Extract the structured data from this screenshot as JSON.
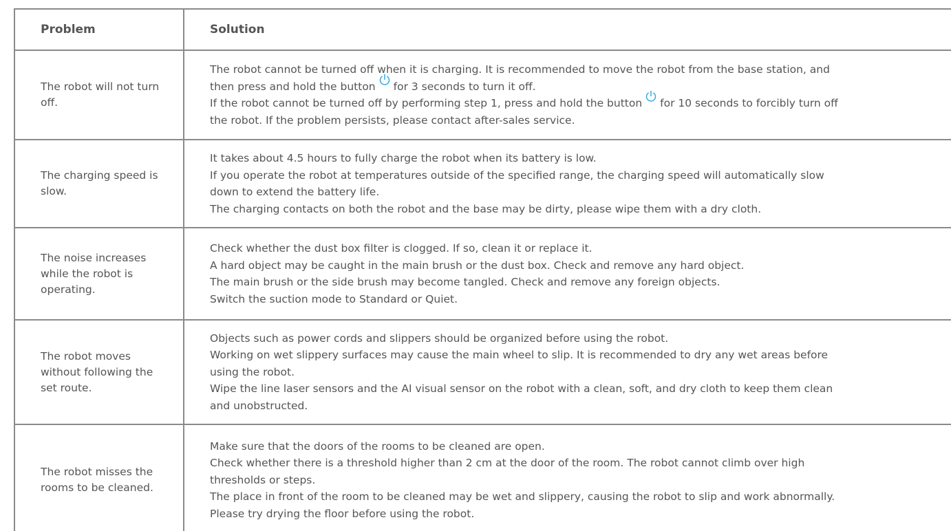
{
  "header": {
    "problem": "Problem",
    "solution": "Solution"
  },
  "icon": "power-icon",
  "accent_color": "#29a3e0",
  "rows": [
    {
      "problem": "The robot will not turn off.",
      "solution": [
        {
          "text": "The robot cannot be turned off when it is charging. It is recommended to move the robot from the base station, and"
        },
        {
          "pre": "then press and hold the button",
          "icon": true,
          "post": "for 3 seconds to turn it off."
        },
        {
          "pre": "If the robot cannot be turned off by performing step 1, press and hold the button",
          "icon": true,
          "post": "for 10 seconds to forcibly turn off"
        },
        {
          "text": "the robot. If the problem persists, please contact after-sales service."
        }
      ]
    },
    {
      "problem": "The charging speed is slow.",
      "solution": [
        {
          "text": "It takes about 4.5 hours to fully charge the robot when its battery is low."
        },
        {
          "text": "If you operate the robot at temperatures outside of the specified range, the charging speed will automatically slow"
        },
        {
          "text": "down to extend the battery life."
        },
        {
          "text": "The charging contacts on both the robot and the base may be dirty, please wipe them with a dry cloth."
        }
      ]
    },
    {
      "problem": "The noise increases while the robot is operating.",
      "solution": [
        {
          "text": "Check whether the dust box filter is clogged. If so, clean it or replace it."
        },
        {
          "text": "A hard object may be caught in the main brush or the dust box. Check and remove any hard object."
        },
        {
          "text": "The main brush or the side brush may become tangled. Check and remove any foreign objects."
        },
        {
          "text": "Switch the suction mode to Standard or Quiet."
        }
      ]
    },
    {
      "problem": "The robot moves without following the set route.",
      "solution": [
        {
          "text": "Objects such as power cords and slippers should be organized before using the robot."
        },
        {
          "text": "Working on wet slippery surfaces may cause the main wheel to slip. It is recommended to dry any wet areas before"
        },
        {
          "text": "using the robot."
        },
        {
          "text": "Wipe the line laser sensors and the AI visual sensor on the robot with a clean, soft, and dry cloth to keep them clean"
        },
        {
          "text": "and unobstructed."
        }
      ]
    },
    {
      "problem": "The robot misses the rooms to be cleaned.",
      "solution": [
        {
          "text": "Make sure that the doors of the rooms to be cleaned are open."
        },
        {
          "text": "Check whether there is a threshold higher than 2 cm at the door of the room. The robot cannot climb over high"
        },
        {
          "text": "thresholds or steps."
        },
        {
          "text": "The place in front of the room to be cleaned may be wet and slippery, causing the robot to slip and work abnormally."
        },
        {
          "text": "Please try drying the floor before using the robot."
        }
      ]
    }
  ]
}
